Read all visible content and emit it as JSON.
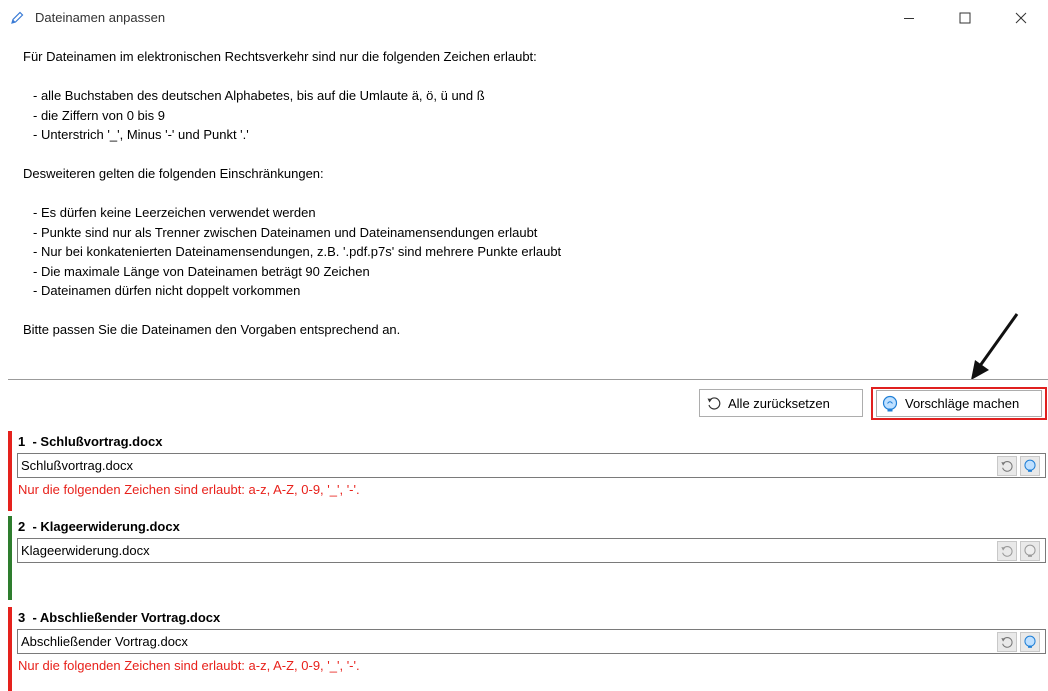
{
  "window": {
    "title": "Dateinamen anpassen",
    "minimize_label": "–",
    "maximize_label": "☐",
    "close_label": "✕"
  },
  "info": {
    "intro": "Für Dateinamen im elektronischen Rechtsverkehr sind nur die folgenden Zeichen erlaubt:",
    "allowed": [
      "- alle Buchstaben des deutschen Alphabetes, bis auf die Umlaute ä, ö, ü und ß",
      "- die Ziffern von 0 bis 9",
      "- Unterstrich '_', Minus '-' und Punkt '.'"
    ],
    "restrictions_intro": "Desweiteren gelten die folgenden Einschränkungen:",
    "restrictions": [
      "- Es dürfen keine Leerzeichen verwendet werden",
      "- Punkte sind nur als Trenner zwischen Dateinamen und Dateinamensendungen erlaubt",
      "- Nur bei konkatenierten Dateinamensendungen, z.B. '.pdf.p7s' sind mehrere Punkte erlaubt",
      "- Die maximale Länge von Dateinamen beträgt 90 Zeichen",
      "- Dateinamen dürfen nicht doppelt vorkommen"
    ],
    "closing": "Bitte passen Sie die Dateinamen den Vorgaben entsprechend an."
  },
  "toolbar": {
    "reset_all_label": "Alle zurücksetzen",
    "suggest_label": "Vorschläge machen"
  },
  "entries": [
    {
      "header": "1  - Schlußvortrag.docx",
      "value": "Schlußvortrag.docx",
      "status": "error",
      "error": "Nur die folgenden Zeichen sind erlaubt: a-z, A-Z, 0-9, '_', '-'."
    },
    {
      "header": "2  - Klageerwiderung.docx",
      "value": "Klageerwiderung.docx",
      "status": "ok",
      "error": ""
    },
    {
      "header": "3  - Abschließender Vortrag.docx",
      "value": "Abschließender Vortrag.docx",
      "status": "error",
      "error": "Nur die folgenden Zeichen sind erlaubt: a-z, A-Z, 0-9, '_', '-'."
    }
  ],
  "colors": {
    "error": "#e8211b",
    "ok": "#2e7d2e",
    "highlight_border": "#e0201f",
    "bulb_active": "#1f7fd6"
  },
  "icons": {
    "title": "pencil-icon",
    "reset": "undo-icon",
    "suggest": "lightbulb-icon"
  }
}
